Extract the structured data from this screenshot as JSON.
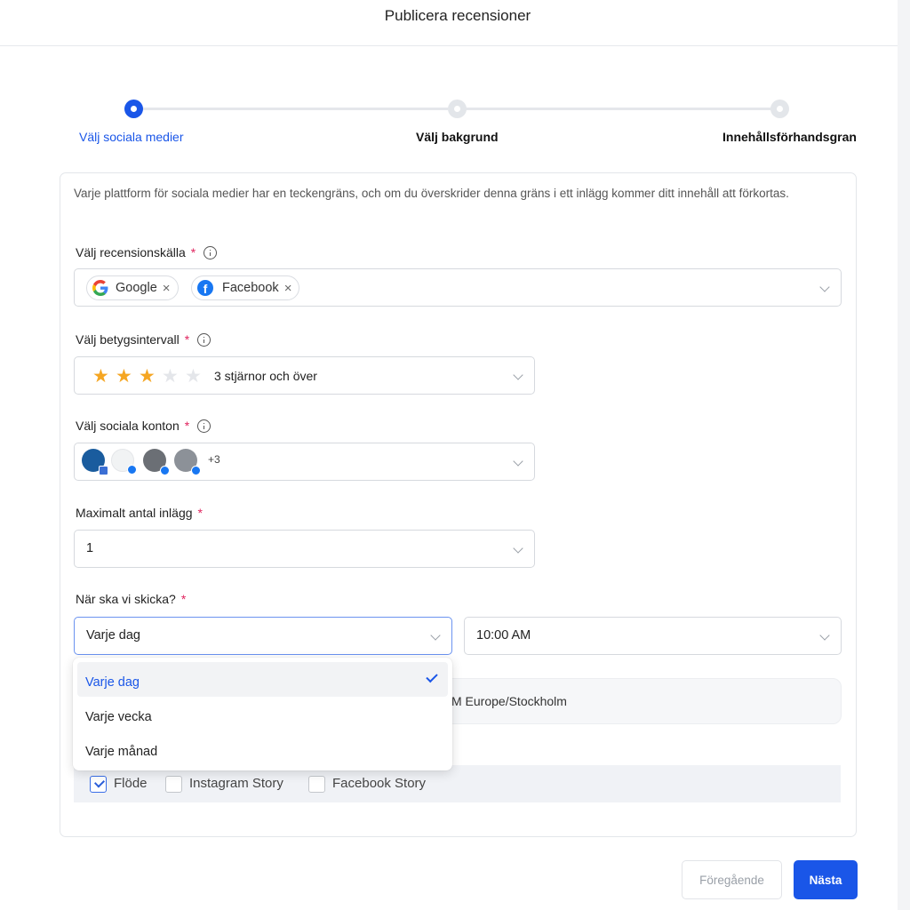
{
  "header": {
    "title": "Publicera recensioner"
  },
  "stepper": {
    "steps": [
      {
        "label": "Välj sociala medier",
        "state": "active"
      },
      {
        "label": "Välj bakgrund",
        "state": "inactive"
      },
      {
        "label": "Innehållsförhandsgran",
        "state": "inactive"
      }
    ]
  },
  "info": {
    "text": "Varje plattform för sociala medier har en teckengräns, och om du överskrider denna gräns i ett inlägg kommer ditt innehåll att förkortas."
  },
  "review_source": {
    "label": "Välj recensionskälla",
    "required_mark": "*",
    "tags": [
      {
        "label": "Google",
        "icon": "google-icon",
        "remove": "×"
      },
      {
        "label": "Facebook",
        "icon": "facebook-icon",
        "remove": "×"
      }
    ]
  },
  "rating": {
    "label": "Välj betygsintervall",
    "required_mark": "*",
    "stars_filled": 3,
    "stars_total": 5,
    "star_glyph": "★",
    "value": "3 stjärnor och över",
    "star_color": "#f5a623"
  },
  "accounts": {
    "label": "Välj sociala konton",
    "required_mark": "*",
    "more_count": "+3"
  },
  "max_posts": {
    "label": "Maximalt antal inlägg",
    "required_mark": "*",
    "value": "1"
  },
  "schedule": {
    "label": "När ska vi skicka?",
    "required_mark": "*",
    "frequency": "Varje dag",
    "time": "10:00 AM",
    "options": [
      "Varje dag",
      "Varje vecka",
      "Varje månad"
    ],
    "selected_option": "Varje dag",
    "timezone_text": "M Europe/Stockholm"
  },
  "post_types": [
    {
      "label": "Flöde",
      "checked": true
    },
    {
      "label": "Instagram Story",
      "checked": false
    },
    {
      "label": "Facebook Story",
      "checked": false
    }
  ],
  "footer": {
    "prev_label": "Föregående",
    "next_label": "Nästa"
  },
  "colors": {
    "primary": "#1a56e8",
    "required": "#e0245e",
    "facebook": "#1877f2"
  }
}
